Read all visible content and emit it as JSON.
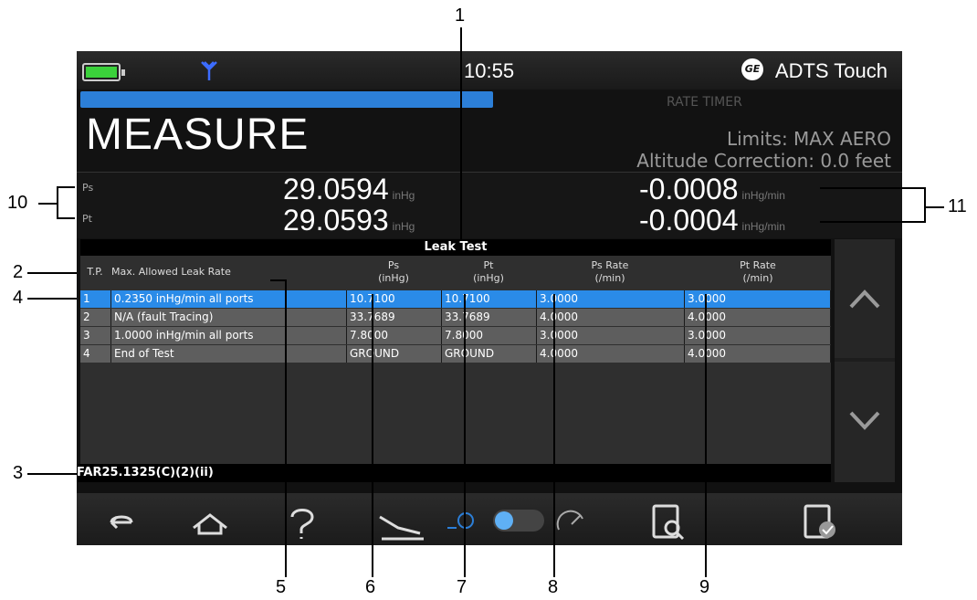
{
  "status": {
    "time": "10:55",
    "brand": "ADTS Touch",
    "logo_text": "GE"
  },
  "header": {
    "mode": "MEASURE",
    "rate_timer": "RATE TIMER",
    "limits": "Limits: MAX AERO",
    "altitude_correction": "Altitude Correction: 0.0 feet",
    "progress": 0.5
  },
  "readings": {
    "ps": {
      "label": "Ps",
      "value": "29.0594",
      "unit": "inHg",
      "rate": "-0.0008",
      "rate_unit": "inHg/min"
    },
    "pt": {
      "label": "Pt",
      "value": "29.0593",
      "unit": "inHg",
      "rate": "-0.0004",
      "rate_unit": "inHg/min"
    }
  },
  "table": {
    "title": "Leak Test",
    "headers": {
      "tp": "T.P.",
      "max_rate": "Max. Allowed Leak Rate",
      "ps": "Ps\n(inHg)",
      "pt": "Pt\n(inHg)",
      "ps_rate": "Ps Rate\n(/min)",
      "pt_rate": "Pt Rate\n(/min)"
    },
    "rows": [
      {
        "tp": "1",
        "max_rate": "0.2350 inHg/min all ports",
        "ps": "10.7100",
        "pt": "10.7100",
        "ps_rate": "3.0000",
        "pt_rate": "3.0000"
      },
      {
        "tp": "2",
        "max_rate": "N/A  (fault Tracing)",
        "ps": "33.7689",
        "pt": "33.7689",
        "ps_rate": "4.0000",
        "pt_rate": "4.0000"
      },
      {
        "tp": "3",
        "max_rate": "1.0000 inHg/min all ports",
        "ps": "7.8000",
        "pt": "7.8000",
        "ps_rate": "3.0000",
        "pt_rate": "3.0000"
      },
      {
        "tp": "4",
        "max_rate": "End of Test",
        "ps": "GROUND",
        "pt": "GROUND",
        "ps_rate": "4.0000",
        "pt_rate": "4.0000"
      }
    ],
    "footer": "FAR25.1325(C)(2)(ii)"
  },
  "callouts": {
    "c1": "1",
    "c2": "2",
    "c3": "3",
    "c4": "4",
    "c5": "5",
    "c6": "6",
    "c7": "7",
    "c8": "8",
    "c9": "9",
    "c10": "10",
    "c11": "11"
  },
  "colors": {
    "accent": "#2c7fd8",
    "selected_row": "#2a8be8",
    "row": "#5e5e5e",
    "battery": "#3bd13b"
  }
}
